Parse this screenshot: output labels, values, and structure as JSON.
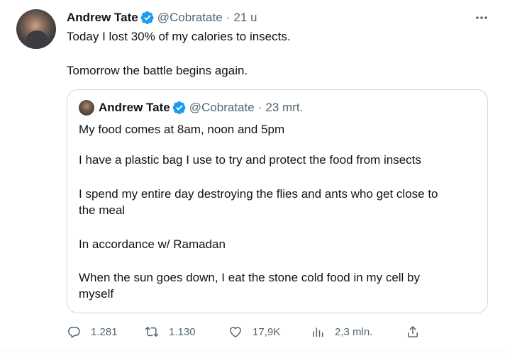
{
  "tweet": {
    "author_name": "Andrew Tate",
    "handle": "@Cobratate",
    "separator": "·",
    "time": "21 u",
    "lines": [
      "Today I lost 30% of my calories to insects.",
      "Tomorrow the battle begins again."
    ]
  },
  "quoted": {
    "author_name": "Andrew Tate",
    "handle": "@Cobratate",
    "separator": "·",
    "time": "23 mrt.",
    "lines": [
      "My food comes at 8am, noon and 5pm",
      "I have a plastic bag I use to try and protect the food from insects",
      "I spend my entire day destroying the flies and ants who get close to",
      "the meal",
      "In accordance w/ Ramadan",
      "When the sun goes down, I eat the stone cold food in my cell by",
      "myself"
    ]
  },
  "actions": {
    "replies": "1.281",
    "reposts": "1.130",
    "likes": "17,9K",
    "views": "2,3 mln."
  },
  "icons": {
    "verified": "verified-badge-icon",
    "more": "more-dots-icon",
    "reply": "reply-icon",
    "repost": "repost-icon",
    "like": "heart-icon",
    "views": "views-chart-icon",
    "share": "share-icon"
  },
  "colors": {
    "verified_blue": "#1d9bf0",
    "secondary_text": "#536471",
    "primary_text": "#0f1419",
    "border": "#cfd9de"
  }
}
